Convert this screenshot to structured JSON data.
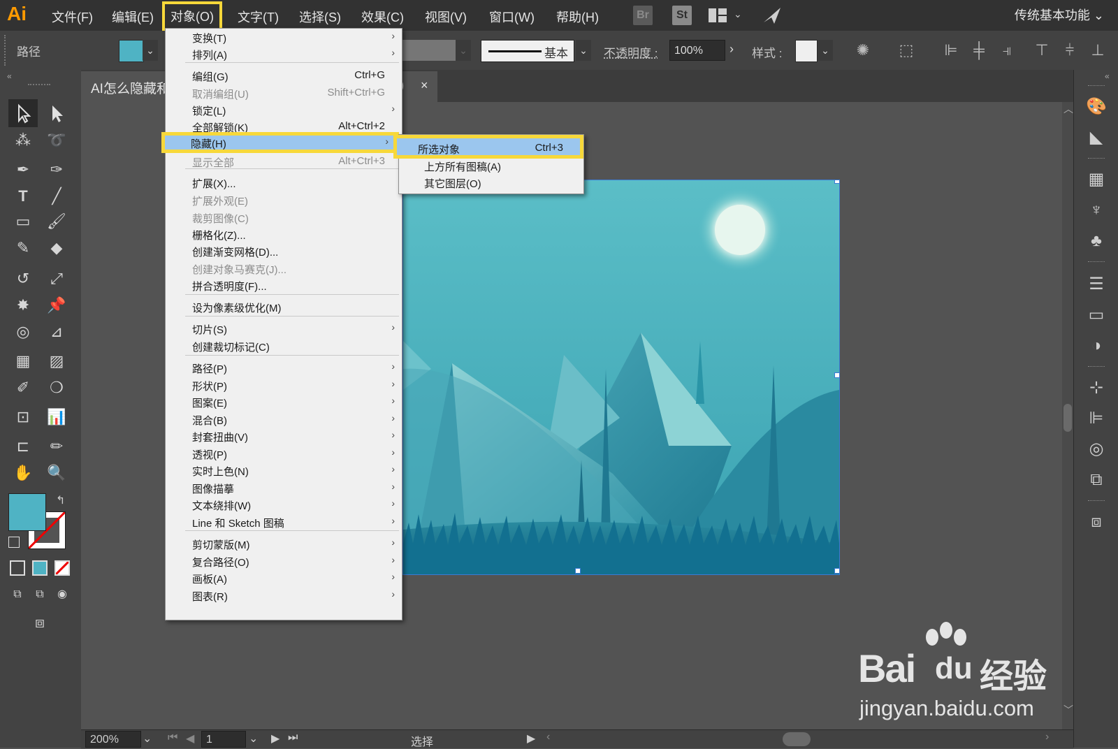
{
  "app": {
    "logo": "Ai",
    "workspace": "传统基本功能"
  },
  "menubar": {
    "items": [
      "文件(F)",
      "编辑(E)",
      "对象(O)",
      "文字(T)",
      "选择(S)",
      "效果(C)",
      "视图(V)",
      "窗口(W)",
      "帮助(H)"
    ],
    "bridge_label": "Br",
    "stock_label": "St"
  },
  "controlbar": {
    "selection_type": "路径",
    "fill_color": "#4fb3c4",
    "stroke_profile": "基本",
    "opacity_label": "不透明度 :",
    "opacity_value": "100%",
    "style_label": "样式 :"
  },
  "document": {
    "tab_title": "AI怎么隐藏和",
    "tab_title_suffix": ")",
    "close": "×"
  },
  "object_menu": {
    "items": [
      {
        "label": "变换(T)",
        "shortcut": "",
        "submenu": true,
        "disabled": false
      },
      {
        "label": "排列(A)",
        "shortcut": "",
        "submenu": true,
        "disabled": false
      },
      {
        "label": "编组(G)",
        "shortcut": "Ctrl+G",
        "submenu": false,
        "disabled": false
      },
      {
        "label": "取消编组(U)",
        "shortcut": "Shift+Ctrl+G",
        "submenu": false,
        "disabled": true
      },
      {
        "label": "锁定(L)",
        "shortcut": "",
        "submenu": true,
        "disabled": false
      },
      {
        "label": "全部解锁(K)",
        "shortcut": "Alt+Ctrl+2",
        "submenu": false,
        "disabled": false
      },
      {
        "label": "隐藏(H)",
        "shortcut": "",
        "submenu": true,
        "disabled": false
      },
      {
        "label": "显示全部",
        "shortcut": "Alt+Ctrl+3",
        "submenu": false,
        "disabled": true
      },
      {
        "label": "扩展(X)...",
        "shortcut": "",
        "submenu": false,
        "disabled": false
      },
      {
        "label": "扩展外观(E)",
        "shortcut": "",
        "submenu": false,
        "disabled": true
      },
      {
        "label": "裁剪图像(C)",
        "shortcut": "",
        "submenu": false,
        "disabled": true
      },
      {
        "label": "栅格化(Z)...",
        "shortcut": "",
        "submenu": false,
        "disabled": false
      },
      {
        "label": "创建渐变网格(D)...",
        "shortcut": "",
        "submenu": false,
        "disabled": false
      },
      {
        "label": "创建对象马赛克(J)...",
        "shortcut": "",
        "submenu": false,
        "disabled": true
      },
      {
        "label": "拼合透明度(F)...",
        "shortcut": "",
        "submenu": false,
        "disabled": false
      },
      {
        "label": "设为像素级优化(M)",
        "shortcut": "",
        "submenu": false,
        "disabled": false
      },
      {
        "label": "切片(S)",
        "shortcut": "",
        "submenu": true,
        "disabled": false
      },
      {
        "label": "创建裁切标记(C)",
        "shortcut": "",
        "submenu": false,
        "disabled": false
      },
      {
        "label": "路径(P)",
        "shortcut": "",
        "submenu": true,
        "disabled": false
      },
      {
        "label": "形状(P)",
        "shortcut": "",
        "submenu": true,
        "disabled": false
      },
      {
        "label": "图案(E)",
        "shortcut": "",
        "submenu": true,
        "disabled": false
      },
      {
        "label": "混合(B)",
        "shortcut": "",
        "submenu": true,
        "disabled": false
      },
      {
        "label": "封套扭曲(V)",
        "shortcut": "",
        "submenu": true,
        "disabled": false
      },
      {
        "label": "透视(P)",
        "shortcut": "",
        "submenu": true,
        "disabled": false
      },
      {
        "label": "实时上色(N)",
        "shortcut": "",
        "submenu": true,
        "disabled": false
      },
      {
        "label": "图像描摹",
        "shortcut": "",
        "submenu": true,
        "disabled": false
      },
      {
        "label": "文本绕排(W)",
        "shortcut": "",
        "submenu": true,
        "disabled": false
      },
      {
        "label": "Line 和 Sketch 图稿",
        "shortcut": "",
        "submenu": true,
        "disabled": false
      },
      {
        "label": "剪切蒙版(M)",
        "shortcut": "",
        "submenu": true,
        "disabled": false
      },
      {
        "label": "复合路径(O)",
        "shortcut": "",
        "submenu": true,
        "disabled": false
      },
      {
        "label": "画板(A)",
        "shortcut": "",
        "submenu": true,
        "disabled": false
      },
      {
        "label": "图表(R)",
        "shortcut": "",
        "submenu": true,
        "disabled": false
      }
    ]
  },
  "hide_submenu": {
    "items": [
      {
        "label": "所选对象",
        "shortcut": "Ctrl+3"
      },
      {
        "label": "上方所有图稿(A)",
        "shortcut": ""
      },
      {
        "label": "其它图层(O)",
        "shortcut": ""
      }
    ]
  },
  "statusbar": {
    "zoom": "200%",
    "artboard": "1",
    "tool": "选择"
  },
  "watermark": {
    "brand": "Bai",
    "brand_du": "du",
    "brand_cn": "经验",
    "url": "jingyan.baidu.com"
  },
  "colors": {
    "fill": "#4fb3c4",
    "highlight": "#f7d83a",
    "menu_hover": "#9bc6ee"
  }
}
